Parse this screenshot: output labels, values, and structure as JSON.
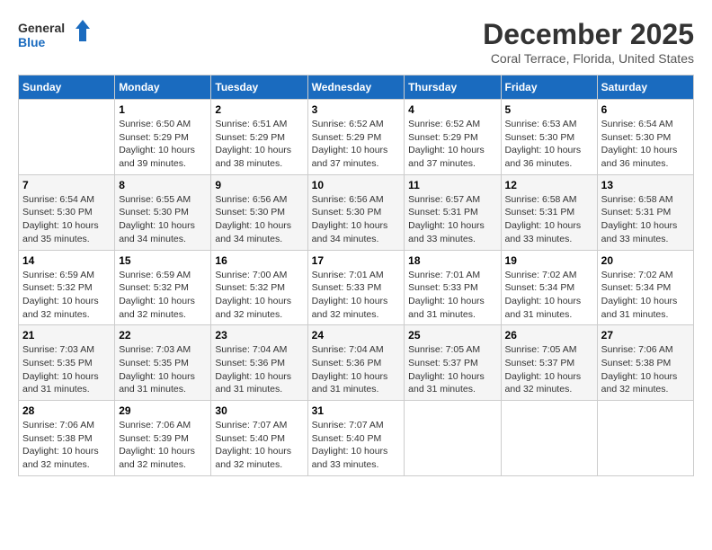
{
  "logo": {
    "line1": "General",
    "line2": "Blue"
  },
  "title": "December 2025",
  "location": "Coral Terrace, Florida, United States",
  "weekdays": [
    "Sunday",
    "Monday",
    "Tuesday",
    "Wednesday",
    "Thursday",
    "Friday",
    "Saturday"
  ],
  "weeks": [
    [
      {
        "day": "",
        "info": ""
      },
      {
        "day": "1",
        "info": "Sunrise: 6:50 AM\nSunset: 5:29 PM\nDaylight: 10 hours\nand 39 minutes."
      },
      {
        "day": "2",
        "info": "Sunrise: 6:51 AM\nSunset: 5:29 PM\nDaylight: 10 hours\nand 38 minutes."
      },
      {
        "day": "3",
        "info": "Sunrise: 6:52 AM\nSunset: 5:29 PM\nDaylight: 10 hours\nand 37 minutes."
      },
      {
        "day": "4",
        "info": "Sunrise: 6:52 AM\nSunset: 5:29 PM\nDaylight: 10 hours\nand 37 minutes."
      },
      {
        "day": "5",
        "info": "Sunrise: 6:53 AM\nSunset: 5:30 PM\nDaylight: 10 hours\nand 36 minutes."
      },
      {
        "day": "6",
        "info": "Sunrise: 6:54 AM\nSunset: 5:30 PM\nDaylight: 10 hours\nand 36 minutes."
      }
    ],
    [
      {
        "day": "7",
        "info": "Sunrise: 6:54 AM\nSunset: 5:30 PM\nDaylight: 10 hours\nand 35 minutes."
      },
      {
        "day": "8",
        "info": "Sunrise: 6:55 AM\nSunset: 5:30 PM\nDaylight: 10 hours\nand 34 minutes."
      },
      {
        "day": "9",
        "info": "Sunrise: 6:56 AM\nSunset: 5:30 PM\nDaylight: 10 hours\nand 34 minutes."
      },
      {
        "day": "10",
        "info": "Sunrise: 6:56 AM\nSunset: 5:30 PM\nDaylight: 10 hours\nand 34 minutes."
      },
      {
        "day": "11",
        "info": "Sunrise: 6:57 AM\nSunset: 5:31 PM\nDaylight: 10 hours\nand 33 minutes."
      },
      {
        "day": "12",
        "info": "Sunrise: 6:58 AM\nSunset: 5:31 PM\nDaylight: 10 hours\nand 33 minutes."
      },
      {
        "day": "13",
        "info": "Sunrise: 6:58 AM\nSunset: 5:31 PM\nDaylight: 10 hours\nand 33 minutes."
      }
    ],
    [
      {
        "day": "14",
        "info": "Sunrise: 6:59 AM\nSunset: 5:32 PM\nDaylight: 10 hours\nand 32 minutes."
      },
      {
        "day": "15",
        "info": "Sunrise: 6:59 AM\nSunset: 5:32 PM\nDaylight: 10 hours\nand 32 minutes."
      },
      {
        "day": "16",
        "info": "Sunrise: 7:00 AM\nSunset: 5:32 PM\nDaylight: 10 hours\nand 32 minutes."
      },
      {
        "day": "17",
        "info": "Sunrise: 7:01 AM\nSunset: 5:33 PM\nDaylight: 10 hours\nand 32 minutes."
      },
      {
        "day": "18",
        "info": "Sunrise: 7:01 AM\nSunset: 5:33 PM\nDaylight: 10 hours\nand 31 minutes."
      },
      {
        "day": "19",
        "info": "Sunrise: 7:02 AM\nSunset: 5:34 PM\nDaylight: 10 hours\nand 31 minutes."
      },
      {
        "day": "20",
        "info": "Sunrise: 7:02 AM\nSunset: 5:34 PM\nDaylight: 10 hours\nand 31 minutes."
      }
    ],
    [
      {
        "day": "21",
        "info": "Sunrise: 7:03 AM\nSunset: 5:35 PM\nDaylight: 10 hours\nand 31 minutes."
      },
      {
        "day": "22",
        "info": "Sunrise: 7:03 AM\nSunset: 5:35 PM\nDaylight: 10 hours\nand 31 minutes."
      },
      {
        "day": "23",
        "info": "Sunrise: 7:04 AM\nSunset: 5:36 PM\nDaylight: 10 hours\nand 31 minutes."
      },
      {
        "day": "24",
        "info": "Sunrise: 7:04 AM\nSunset: 5:36 PM\nDaylight: 10 hours\nand 31 minutes."
      },
      {
        "day": "25",
        "info": "Sunrise: 7:05 AM\nSunset: 5:37 PM\nDaylight: 10 hours\nand 31 minutes."
      },
      {
        "day": "26",
        "info": "Sunrise: 7:05 AM\nSunset: 5:37 PM\nDaylight: 10 hours\nand 32 minutes."
      },
      {
        "day": "27",
        "info": "Sunrise: 7:06 AM\nSunset: 5:38 PM\nDaylight: 10 hours\nand 32 minutes."
      }
    ],
    [
      {
        "day": "28",
        "info": "Sunrise: 7:06 AM\nSunset: 5:38 PM\nDaylight: 10 hours\nand 32 minutes."
      },
      {
        "day": "29",
        "info": "Sunrise: 7:06 AM\nSunset: 5:39 PM\nDaylight: 10 hours\nand 32 minutes."
      },
      {
        "day": "30",
        "info": "Sunrise: 7:07 AM\nSunset: 5:40 PM\nDaylight: 10 hours\nand 32 minutes."
      },
      {
        "day": "31",
        "info": "Sunrise: 7:07 AM\nSunset: 5:40 PM\nDaylight: 10 hours\nand 33 minutes."
      },
      {
        "day": "",
        "info": ""
      },
      {
        "day": "",
        "info": ""
      },
      {
        "day": "",
        "info": ""
      }
    ]
  ]
}
